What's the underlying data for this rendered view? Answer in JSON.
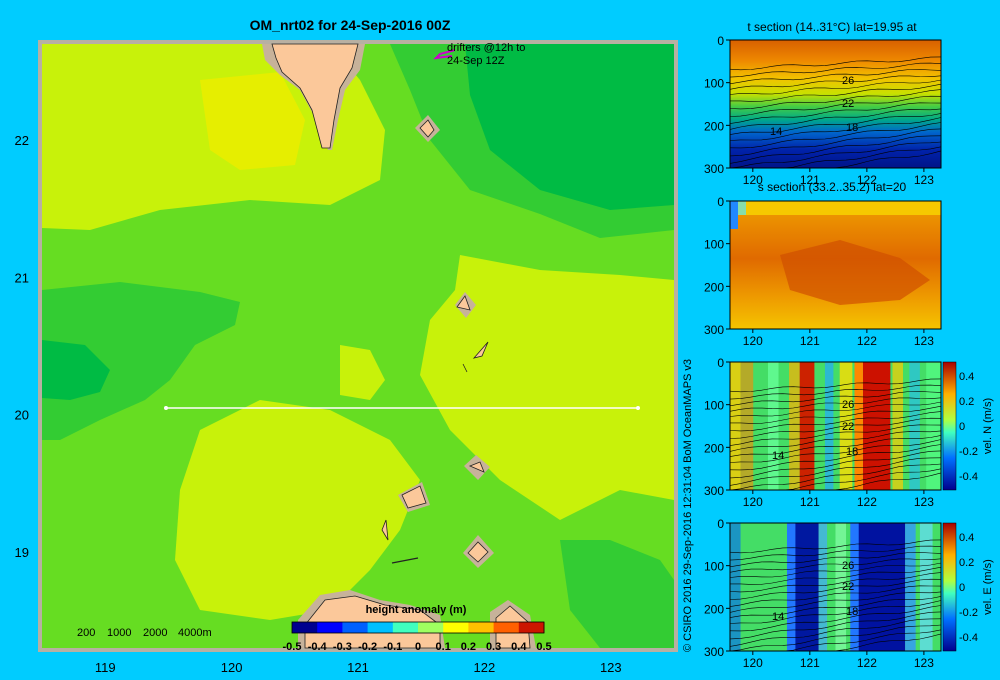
{
  "colors": {
    "background": "#00ccff",
    "land": "#fbc89a",
    "shelf": "#c7b29a",
    "frame": "#b8b0a2",
    "transect": "#ffffff",
    "drifter": "#cc00cc",
    "map_fill_levels": [
      "#00bb44",
      "#33cc33",
      "#66dd22",
      "#99ee11",
      "#c8f20a",
      "#e6ee00"
    ]
  },
  "map": {
    "title": "OM_nrt02 for 24-Sep-2016 00Z",
    "drifter_label": [
      "drifters @12h to",
      "24-Sep 12Z"
    ],
    "depth_legend": [
      "200",
      "1000",
      "2000",
      "4000m"
    ],
    "colorbar_title": "height anomaly (m)",
    "colorbar_ticks": [
      "-0.5",
      "-0.4",
      "-0.3",
      "-0.2",
      "-0.1",
      "0",
      "0.1",
      "0.2",
      "0.3",
      "0.4",
      "0.5"
    ],
    "colorbar_colors": [
      "#00008f",
      "#0000ff",
      "#0060ff",
      "#00c0ff",
      "#40ffbf",
      "#9fff60",
      "#ffff00",
      "#ffc000",
      "#ff6000",
      "#cc1500"
    ],
    "credit": "© CSIRO 2016   29-Sep-2016 12:31:04 BoM OceanMAPS v3"
  },
  "chart_data": [
    {
      "type": "heatmap",
      "title": "OM_nrt02 for 24-Sep-2016 00Z",
      "xlabel": "",
      "ylabel": "",
      "xlim": [
        118.5,
        123.5
      ],
      "ylim": [
        18.3,
        22.7
      ],
      "x_ticks": [
        "119",
        "120",
        "121",
        "122",
        "123"
      ],
      "y_ticks": [
        "19",
        "20",
        "21",
        "22"
      ],
      "colorbar": {
        "label": "height anomaly (m)",
        "range": [
          -0.5,
          0.5
        ]
      },
      "transect": {
        "lat": 20,
        "lon": [
          119.5,
          123.2
        ]
      }
    },
    {
      "type": "heatmap",
      "title": "t section (14..31°C) lat=19.95 at",
      "xlim": [
        119.6,
        123.3
      ],
      "ylim": [
        300,
        0
      ],
      "x_ticks": [
        "120",
        "121",
        "122",
        "123"
      ],
      "y_ticks": [
        "0",
        "100",
        "200",
        "300"
      ],
      "contour_labels": [
        "26",
        "22",
        "18",
        "14"
      ]
    },
    {
      "type": "heatmap",
      "title": "s section (33.2..35.2) lat=20",
      "xlim": [
        119.6,
        123.3
      ],
      "ylim": [
        300,
        0
      ],
      "x_ticks": [
        "120",
        "121",
        "122",
        "123"
      ],
      "y_ticks": [
        "0",
        "100",
        "200",
        "300"
      ]
    },
    {
      "type": "heatmap",
      "title": "",
      "xlim": [
        119.6,
        123.3
      ],
      "ylim": [
        300,
        0
      ],
      "x_ticks": [
        "120",
        "121",
        "122",
        "123"
      ],
      "y_ticks": [
        "0",
        "100",
        "200",
        "300"
      ],
      "contour_labels": [
        "26",
        "22",
        "18",
        "14"
      ],
      "colorbar": {
        "label": "vel. N (m/s)",
        "range": [
          -0.4,
          0.4
        ],
        "ticks": [
          "0.4",
          "0.2",
          "0",
          "-0.2",
          "-0.4"
        ]
      }
    },
    {
      "type": "heatmap",
      "title": "",
      "xlim": [
        119.6,
        123.3
      ],
      "ylim": [
        300,
        0
      ],
      "x_ticks": [
        "120",
        "121",
        "122",
        "123"
      ],
      "y_ticks": [
        "0",
        "100",
        "200",
        "300"
      ],
      "contour_labels": [
        "26",
        "22",
        "18",
        "14"
      ],
      "colorbar": {
        "label": "vel. E (m/s)",
        "range": [
          -0.4,
          0.4
        ],
        "ticks": [
          "0.4",
          "0.2",
          "0",
          "-0.2",
          "-0.4"
        ]
      }
    }
  ]
}
